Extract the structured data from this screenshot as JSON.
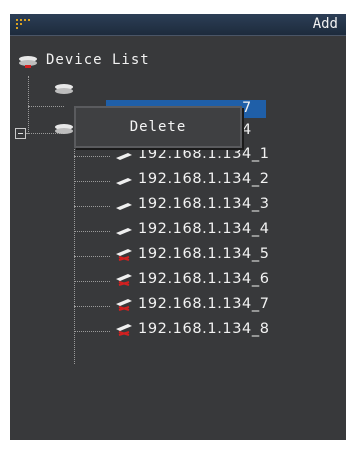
{
  "toolbar": {
    "add_label": "Add"
  },
  "tree": {
    "root_label": "Device List",
    "hidden_node_1_label_fragment": "4",
    "selected_node_label_fragment": "7",
    "children": [
      "192.168.1.134_1",
      "192.168.1.134_2",
      "192.168.1.134_3",
      "192.168.1.134_4",
      "192.168.1.134_5",
      "192.168.1.134_6",
      "192.168.1.134_7",
      "192.168.1.134_8"
    ],
    "child_status": [
      "online",
      "online",
      "online",
      "online",
      "offline",
      "offline",
      "offline",
      "offline"
    ]
  },
  "context_menu": {
    "items": [
      "Delete"
    ]
  },
  "icons": {
    "grip": "grip-dots-icon",
    "device_group": "device-group-icon",
    "camera_online": "camera-online-icon",
    "camera_offline": "camera-offline-icon",
    "expander": "collapse-minus-icon"
  },
  "colors": {
    "panel_bg": "#38393b",
    "titlebar": "#1d2b3c",
    "selection": "#1f5fa8",
    "offline_mark": "#d22020"
  }
}
